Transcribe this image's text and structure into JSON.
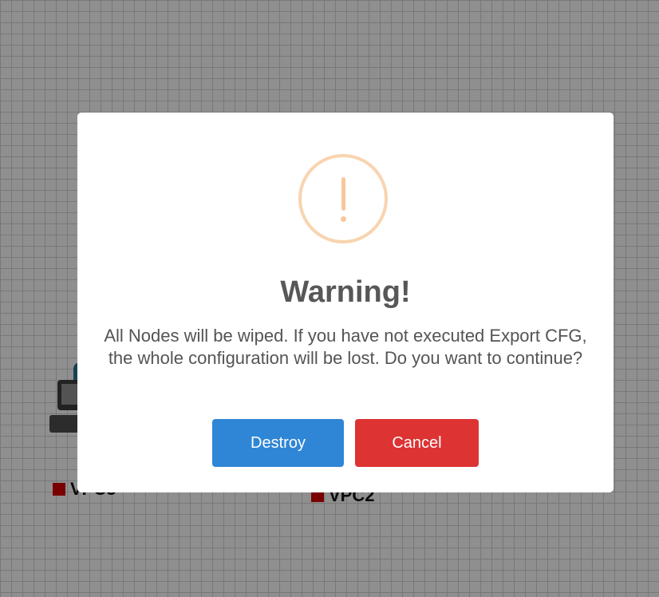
{
  "topology": {
    "nodes": [
      {
        "label": "VPC3",
        "status": "stopped",
        "status_color": "#cc0000"
      },
      {
        "label": "VPC2",
        "status": "stopped",
        "status_color": "#cc0000"
      }
    ]
  },
  "dialog": {
    "icon": "exclamation-icon",
    "title": "Warning!",
    "message": "All Nodes will be wiped. If you have not executed Export CFG, the whole configuration will be lost. Do you want to continue?",
    "confirm_label": "Destroy",
    "cancel_label": "Cancel",
    "colors": {
      "confirm": "#2f86d6",
      "cancel": "#dd3333",
      "warning_icon": "#f8c79b"
    }
  }
}
